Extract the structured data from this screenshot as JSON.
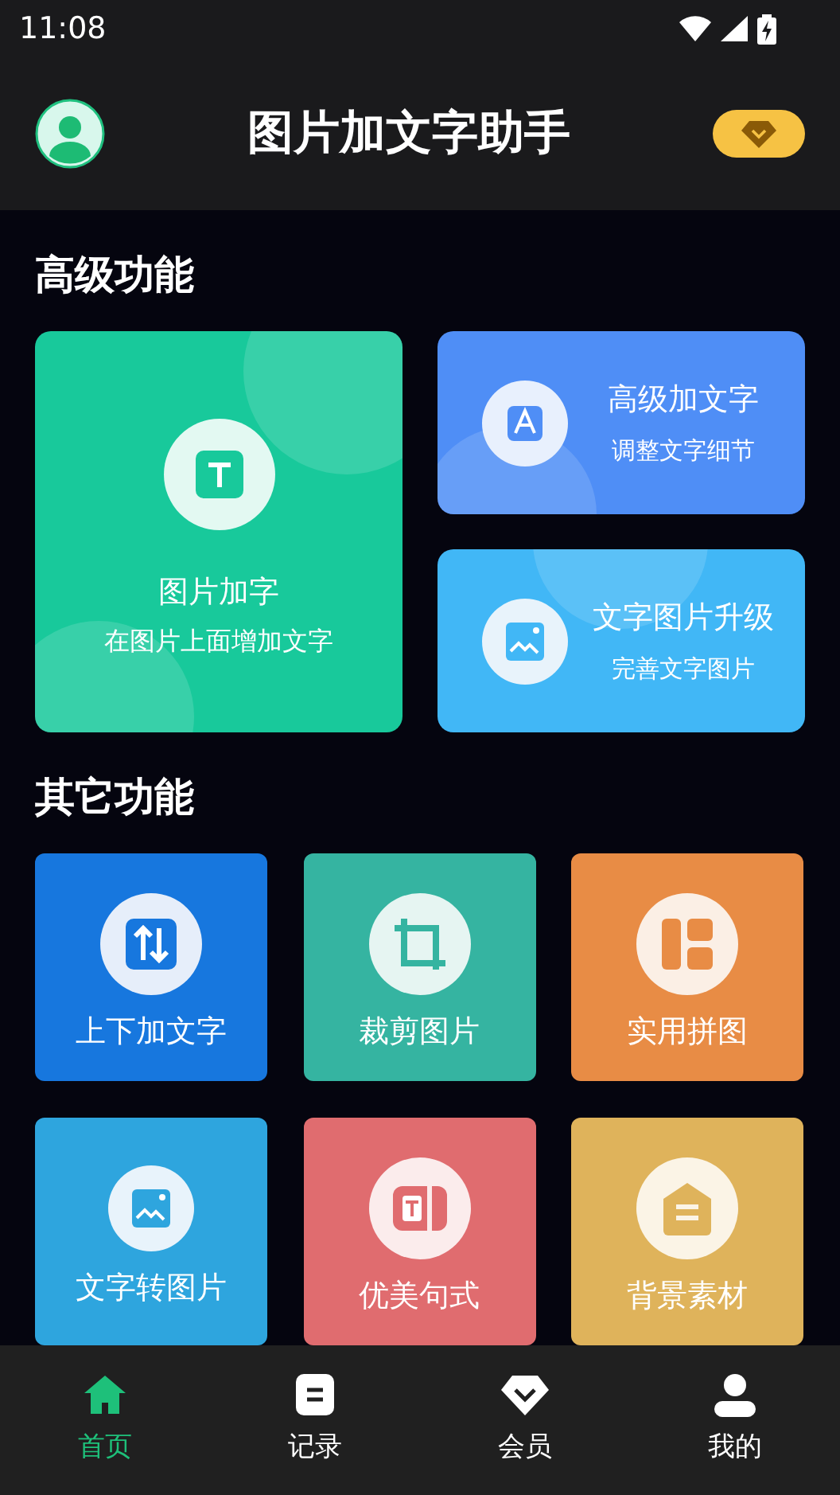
{
  "status_bar": {
    "time": "11:08"
  },
  "header": {
    "title": "图片加文字助手"
  },
  "sections": [
    {
      "title": "高级功能"
    },
    {
      "title": "其它功能"
    }
  ],
  "main_feature": {
    "title": "图片加字",
    "subtitle": "在图片上面增加文字"
  },
  "side_features": [
    {
      "kind": "text",
      "title": "高级加文字",
      "subtitle": "调整文字细节",
      "color": "#4f8ef6"
    },
    {
      "kind": "image",
      "title": "文字图片升级",
      "subtitle": "完善文字图片",
      "color": "#41b7f6"
    }
  ],
  "tools": [
    {
      "kind": "swap",
      "label": "上下加文字",
      "color": "#1777de"
    },
    {
      "kind": "crop",
      "label": "裁剪图片",
      "color": "#35b4a1"
    },
    {
      "kind": "layout",
      "label": "实用拼图",
      "color": "#e88c45"
    },
    {
      "kind": "image",
      "label": "文字转图片",
      "color": "#2ea5de"
    },
    {
      "kind": "split",
      "label": "优美句式",
      "color": "#e06c6f"
    },
    {
      "kind": "house",
      "label": "背景素材",
      "color": "#dfb35b"
    }
  ],
  "bottom_nav": [
    {
      "kind": "home",
      "label": "首页",
      "selected": true
    },
    {
      "kind": "record",
      "label": "记录",
      "selected": false
    },
    {
      "kind": "vip",
      "label": "会员",
      "selected": false
    },
    {
      "kind": "user",
      "label": "我的",
      "selected": false
    }
  ]
}
